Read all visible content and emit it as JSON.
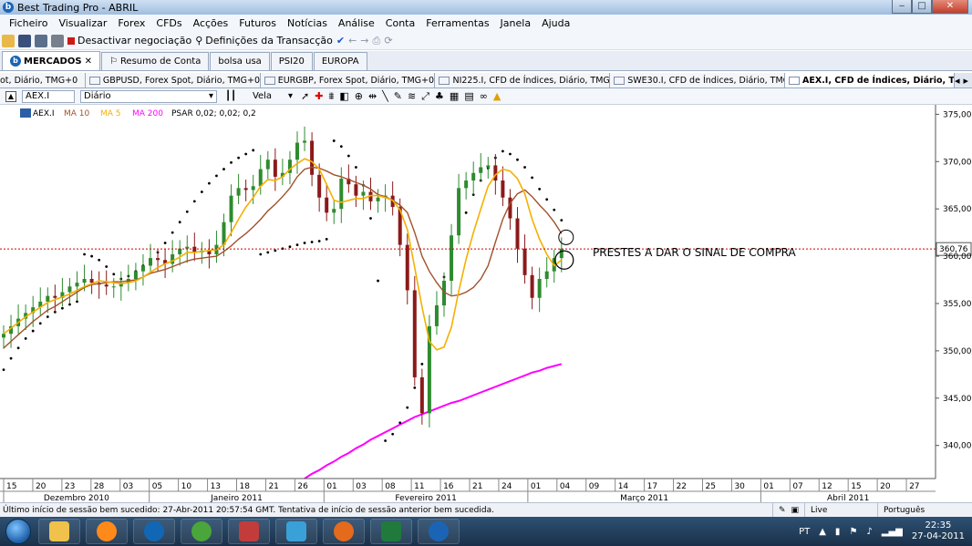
{
  "window": {
    "title": "Best Trading Pro - ABRIL"
  },
  "menu": [
    "Ficheiro",
    "Visualizar",
    "Forex",
    "CFDs",
    "Acções",
    "Futuros",
    "Notícias",
    "Análise",
    "Conta",
    "Ferramentas",
    "Janela",
    "Ajuda"
  ],
  "toolbar": {
    "deactivate": "Desactivar negociação",
    "settings": "Definições da Transacção"
  },
  "main_tabs": [
    {
      "label": "MERCADOS",
      "active": true
    },
    {
      "label": "Resumo de Conta"
    },
    {
      "label": "bolsa usa"
    },
    {
      "label": "PSI20"
    },
    {
      "label": "EUROPA"
    }
  ],
  "chart_tabs": [
    {
      "label": "ot, Diário, TMG+0"
    },
    {
      "label": "GBPUSD, Forex Spot, Diário, TMG+0"
    },
    {
      "label": "EURGBP, Forex Spot, Diário, TMG+0"
    },
    {
      "label": "NI225.I, CFD de Índices, Diário, TMG+0"
    },
    {
      "label": "SWE30.I, CFD de Índices, Diário, TMG+0"
    },
    {
      "label": "AEX.I, CFD de Índices, Diário, TMG+0",
      "active": true
    }
  ],
  "chart_toolbar": {
    "symbol": "AEX.I",
    "period": "Diário",
    "chart_type": "Vela"
  },
  "legend": {
    "symbol": "AEX.I",
    "ma10": "MA 10",
    "ma5": "MA 5",
    "ma200": "MA 200",
    "psar": "PSAR 0,02; 0,02; 0,2"
  },
  "colors": {
    "ma10": "#a0522d",
    "ma5": "#f5b000",
    "ma200": "#ff00ff",
    "candle_up": "#2e8b2e",
    "candle_down": "#8b1a1a",
    "psar": "#000000",
    "current_line": "#d00000"
  },
  "annotation": "PRESTES A DAR O SINAL DE COMPRA",
  "chart_data": {
    "type": "line",
    "title": "AEX.I",
    "current_price": "360,76",
    "ylim": [
      336.5,
      376
    ],
    "y_ticks": [
      "375,00",
      "370,00",
      "365,00",
      "360,00",
      "355,00",
      "350,00",
      "345,00",
      "340,00"
    ],
    "x_day_labels": [
      "15",
      "20",
      "23",
      "28",
      "03",
      "05",
      "10",
      "13",
      "18",
      "21",
      "26",
      "01",
      "03",
      "08",
      "11",
      "16",
      "21",
      "24",
      "01",
      "04",
      "09",
      "14",
      "17",
      "22",
      "25",
      "30",
      "01",
      "07",
      "12",
      "15",
      "20",
      "27"
    ],
    "x_month_labels": [
      "Dezembro 2010",
      "Janeiro 2011",
      "Fevereiro 2011",
      "Março 2011",
      "Abril 2011"
    ],
    "close": [
      351.8,
      352.6,
      353.4,
      354.0,
      354.6,
      355.2,
      355.8,
      355.6,
      356.2,
      356.8,
      357.2,
      357.6,
      357.2,
      357.0,
      356.8,
      356.8,
      357.2,
      357.6,
      358.4,
      359.0,
      359.8,
      359.6,
      359.2,
      360.2,
      360.8,
      361.0,
      360.4,
      360.6,
      360.2,
      361.2,
      363.6,
      366.4,
      367.2,
      367.0,
      367.4,
      369.2,
      370.2,
      368.4,
      368.8,
      370.2,
      372.0,
      372.2,
      368.6,
      366.2,
      364.6,
      365.0,
      368.2,
      367.6,
      366.4,
      366.8,
      365.8,
      366.2,
      366.4,
      365.2,
      361.2,
      356.4,
      347.2,
      343.4,
      352.6,
      354.8,
      357.4,
      362.2,
      367.2,
      368.0,
      368.8,
      369.4,
      369.6,
      368.0,
      366.2,
      364.0,
      360.8,
      358.0,
      355.6,
      357.6,
      358.4,
      359.8,
      360.8
    ],
    "series": [
      {
        "name": "MA 10",
        "values": [
          350.3,
          351.0,
          351.7,
          352.4,
          353.1,
          353.7,
          354.3,
          354.7,
          355.2,
          355.7,
          356.2,
          356.7,
          357.0,
          357.1,
          357.2,
          357.3,
          357.3,
          357.4,
          357.5,
          357.8,
          358.2,
          358.4,
          358.6,
          358.9,
          359.2,
          359.5,
          359.7,
          359.8,
          359.9,
          360.0,
          360.5,
          361.1,
          361.8,
          362.4,
          363.1,
          363.9,
          364.8,
          365.5,
          366.3,
          367.2,
          368.4,
          369.2,
          369.4,
          369.3,
          369.0,
          368.6,
          368.4,
          368.1,
          367.8,
          367.5,
          367.1,
          366.5,
          366.3,
          365.9,
          365.4,
          364.6,
          362.5,
          360.0,
          358.4,
          357.2,
          356.2,
          355.8,
          355.9,
          356.2,
          356.7,
          357.6,
          359.0,
          361.5,
          363.9,
          365.6,
          366.6,
          367.0,
          366.3,
          365.4,
          364.6,
          363.6,
          362.4
        ]
      },
      {
        "name": "MA 5",
        "values": [
          351.8,
          352.4,
          353.0,
          353.6,
          354.1,
          354.6,
          355.1,
          355.4,
          355.7,
          356.0,
          356.4,
          356.8,
          357.1,
          357.4,
          357.3,
          357.2,
          357.1,
          357.2,
          357.4,
          357.8,
          358.3,
          358.8,
          359.2,
          359.5,
          359.9,
          360.4,
          360.4,
          360.5,
          360.6,
          360.7,
          361.2,
          362.5,
          363.9,
          365.2,
          366.2,
          367.4,
          368.1,
          368.0,
          368.4,
          369.2,
          369.8,
          370.3,
          370.0,
          369.2,
          367.6,
          365.9,
          365.7,
          365.9,
          366.1,
          366.1,
          366.4,
          366.4,
          366.2,
          365.9,
          364.9,
          362.8,
          358.8,
          354.6,
          351.0,
          350.1,
          350.4,
          352.5,
          356.3,
          359.7,
          362.5,
          365.0,
          367.4,
          368.6,
          369.2,
          369.0,
          368.2,
          366.6,
          363.9,
          361.8,
          360.2,
          359.0,
          359.6
        ]
      },
      {
        "name": "MA 200",
        "values": [
          336.5,
          337.0,
          337.4,
          337.9,
          338.3,
          338.8,
          339.2,
          339.7,
          340.1,
          340.6,
          341.0,
          341.4,
          341.8,
          342.2,
          342.6,
          343.0,
          343.3,
          343.6,
          343.9,
          344.2,
          344.5,
          344.7,
          345.0,
          345.3,
          345.6,
          345.9,
          346.2,
          346.5,
          346.8,
          347.1,
          347.4,
          347.7,
          347.9,
          348.2,
          348.4,
          348.6
        ]
      },
      {
        "name": "PSAR",
        "values": [
          348.0,
          349.2,
          350.3,
          351.3,
          352.1,
          352.9,
          353.6,
          354.1,
          354.5,
          354.9,
          355.2,
          360.2,
          360.0,
          359.6,
          358.9,
          358.1,
          357.6,
          357.9,
          358.4,
          359.0,
          359.6,
          360.4,
          361.4,
          362.5,
          363.6,
          364.7,
          365.8,
          366.8,
          367.7,
          368.5,
          369.2,
          369.9,
          370.4,
          370.8,
          371.2,
          360.2,
          360.4,
          360.6,
          360.8,
          361.0,
          361.2,
          361.4,
          361.5,
          361.6,
          361.8,
          372.2,
          371.6,
          370.6,
          369.4,
          367.5,
          364.0,
          357.4,
          340.5,
          341.2,
          342.4,
          344.0,
          346.1,
          348.6,
          351.6,
          354.7,
          357.8,
          360.4,
          362.6,
          364.6,
          366.5,
          368.0,
          369.3,
          370.4,
          371.1,
          370.8,
          370.2,
          369.4,
          368.3,
          367.1,
          366.0,
          364.9,
          363.8
        ]
      }
    ]
  },
  "status": {
    "message": "Último início de sessão bem sucedido: 27-Abr-2011 20:57:54 GMT. Tentativa de início de sessão anterior bem sucedida.",
    "live": "Live",
    "language": "Português"
  },
  "taskbar": {
    "lang": "PT",
    "time": "22:35",
    "date": "27-04-2011"
  }
}
